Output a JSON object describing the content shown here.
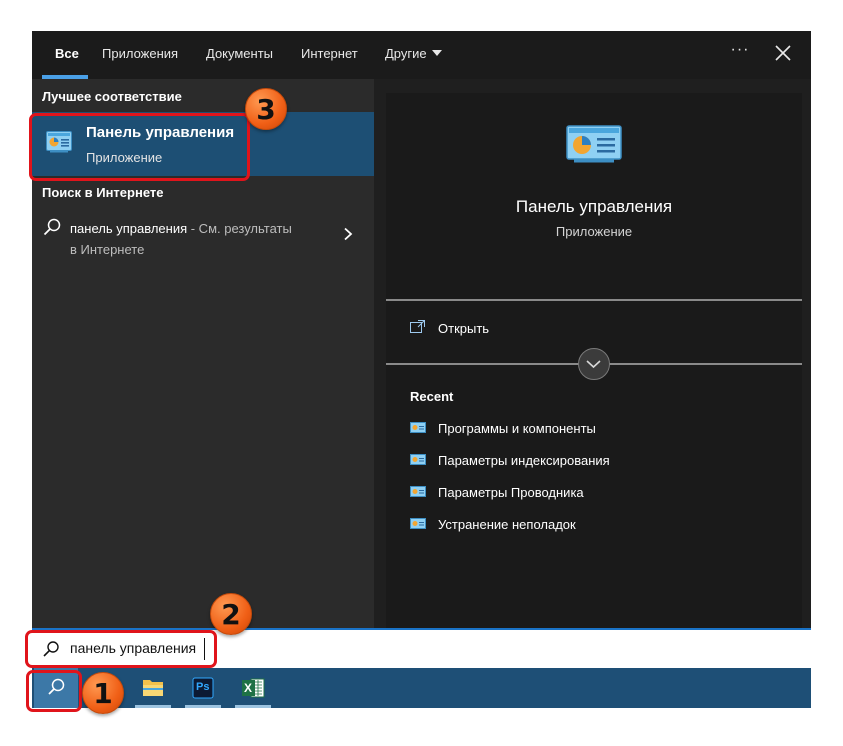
{
  "tabs": [
    {
      "label": "Все"
    },
    {
      "label": "Приложения"
    },
    {
      "label": "Документы"
    },
    {
      "label": "Интернет"
    },
    {
      "label": "Другие"
    }
  ],
  "window_controls": {
    "more": "···"
  },
  "best_match": {
    "section_title": "Лучшее соответствие",
    "title": "Панель управления",
    "subtitle": "Приложение"
  },
  "web_search": {
    "section_title": "Поиск в Интернете",
    "query": "панель управления",
    "suffix": " - См. результаты",
    "suffix_line2": "в Интернете"
  },
  "preview": {
    "title": "Панель управления",
    "subtitle": "Приложение",
    "open_label": "Открыть",
    "recent_title": "Recent",
    "recent_items": [
      {
        "label": "Программы и компоненты"
      },
      {
        "label": "Параметры индексирования"
      },
      {
        "label": "Параметры Проводника"
      },
      {
        "label": "Устранение неполадок"
      }
    ]
  },
  "search_box": {
    "value": "панель управления"
  },
  "taskbar": {
    "apps": [
      {
        "name": "file-explorer"
      },
      {
        "name": "photoshop",
        "label": "Ps"
      },
      {
        "name": "excel",
        "label": "X"
      }
    ]
  },
  "badges": {
    "one": "1",
    "two": "2",
    "three": "3"
  },
  "colors": {
    "accent": "#1d4f74",
    "highlight": "#e0141b",
    "badge": "#f05f16",
    "taskbar": "#1e4f76"
  }
}
